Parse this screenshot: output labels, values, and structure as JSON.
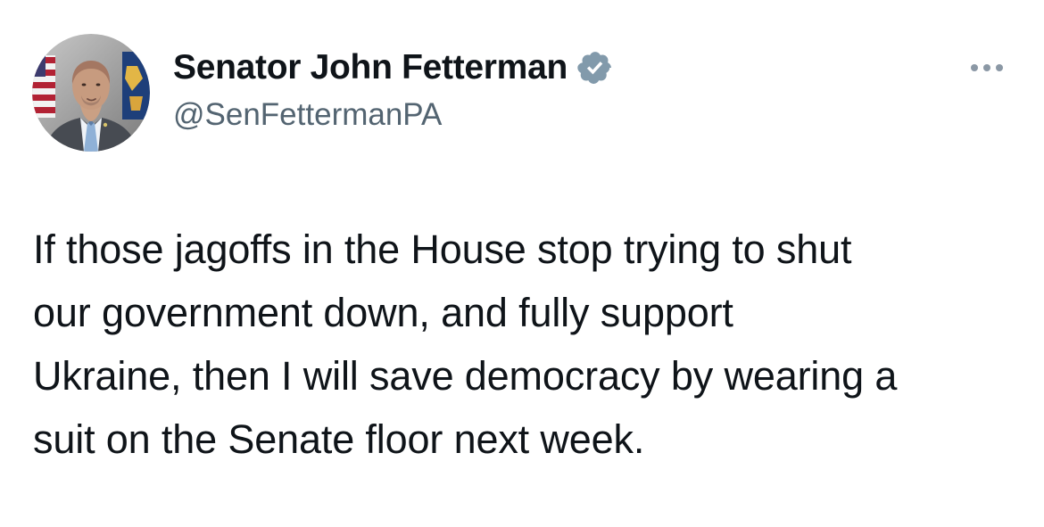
{
  "tweet": {
    "author": {
      "display_name": "Senator John Fetterman",
      "handle": "@SenFettermanPA",
      "verified_badge_icon": "verified-badge-icon",
      "verified_color": "#829aab",
      "avatar_icon": "profile-avatar-image"
    },
    "more_icon": "more-options-icon",
    "body": "If those jagoffs in the House stop trying to shut\nour government down, and fully support\nUkraine, then I will save democracy by wearing a\nsuit on the Senate floor next week."
  }
}
